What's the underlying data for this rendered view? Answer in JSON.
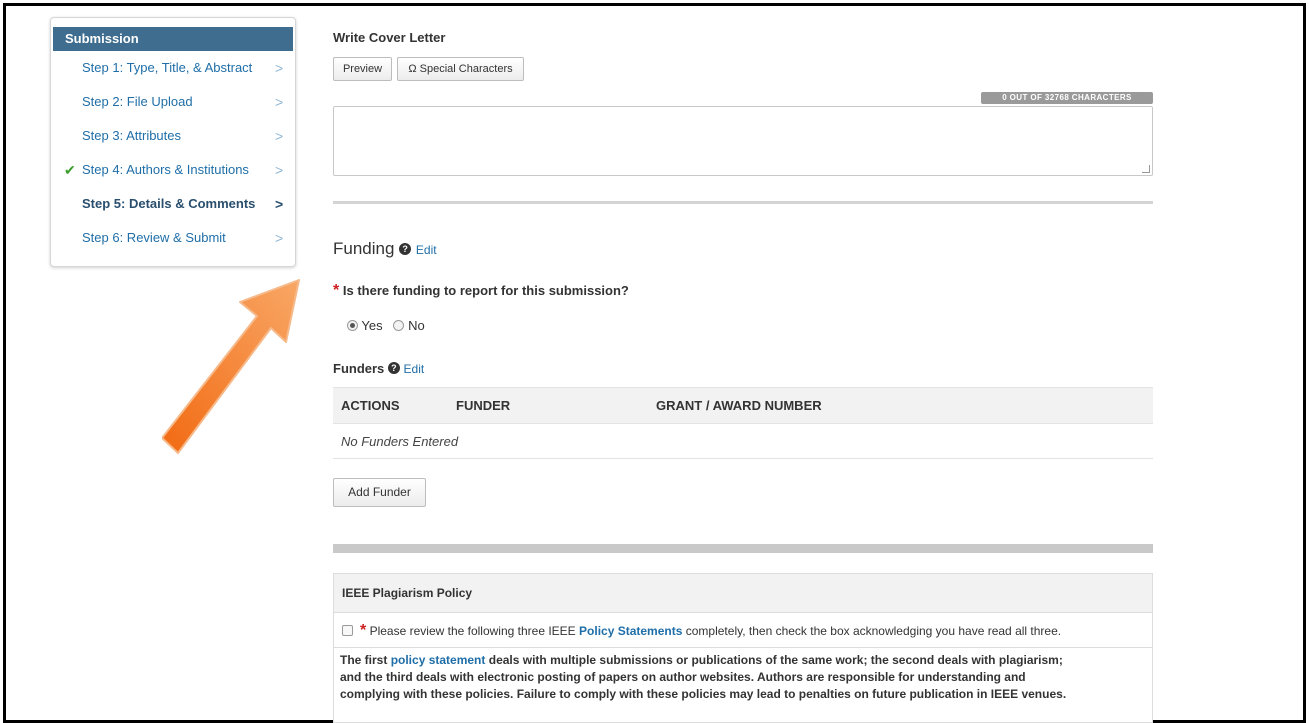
{
  "sidebar": {
    "header": "Submission",
    "steps": [
      {
        "label": "Step 1: Type, Title, & Abstract"
      },
      {
        "label": "Step 2: File Upload"
      },
      {
        "label": "Step 3: Attributes"
      },
      {
        "label": "Step 4: Authors & Institutions",
        "completed": true
      },
      {
        "label": "Step 5: Details & Comments",
        "current": true
      },
      {
        "label": "Step 6: Review & Submit"
      }
    ]
  },
  "cover_letter": {
    "title": "Write Cover Letter",
    "preview_label": "Preview",
    "special_chars_label": "Ω Special Characters",
    "char_count": "0 OUT OF 32768 CHARACTERS",
    "value": ""
  },
  "funding": {
    "heading": "Funding",
    "edit_label": "Edit",
    "question": "Is there funding to report for this submission?",
    "options": [
      "Yes",
      "No"
    ],
    "selected": "Yes",
    "funders_label": "Funders",
    "funders_edit_label": "Edit",
    "table": {
      "columns": [
        "ACTIONS",
        "FUNDER",
        "GRANT / AWARD NUMBER"
      ],
      "empty_text": "No Funders Entered"
    },
    "add_button": "Add Funder"
  },
  "plagiarism": {
    "header": "IEEE Plagiarism Policy",
    "check_text_before": "Please review the following three IEEE",
    "check_link": "Policy Statements",
    "check_text_after": "completely, then check the box acknowledging you have read all three.",
    "body_start": "The first",
    "body_link": "policy statement",
    "body_line1_rest": "deals with multiple submissions or publications of the same work; the second deals with plagiarism;",
    "body_line2": "and the third deals with electronic posting of papers on author websites. Authors are responsible for understanding and",
    "body_line3": "complying with these policies. Failure to comply with these policies may lead to penalties on future publication in IEEE venues."
  },
  "colors": {
    "sidebar_header": "#3f6d8f",
    "link": "#1f6ea8",
    "check": "#3a9d2a",
    "required": "#cc2020",
    "arrow": "#f47c1e"
  }
}
